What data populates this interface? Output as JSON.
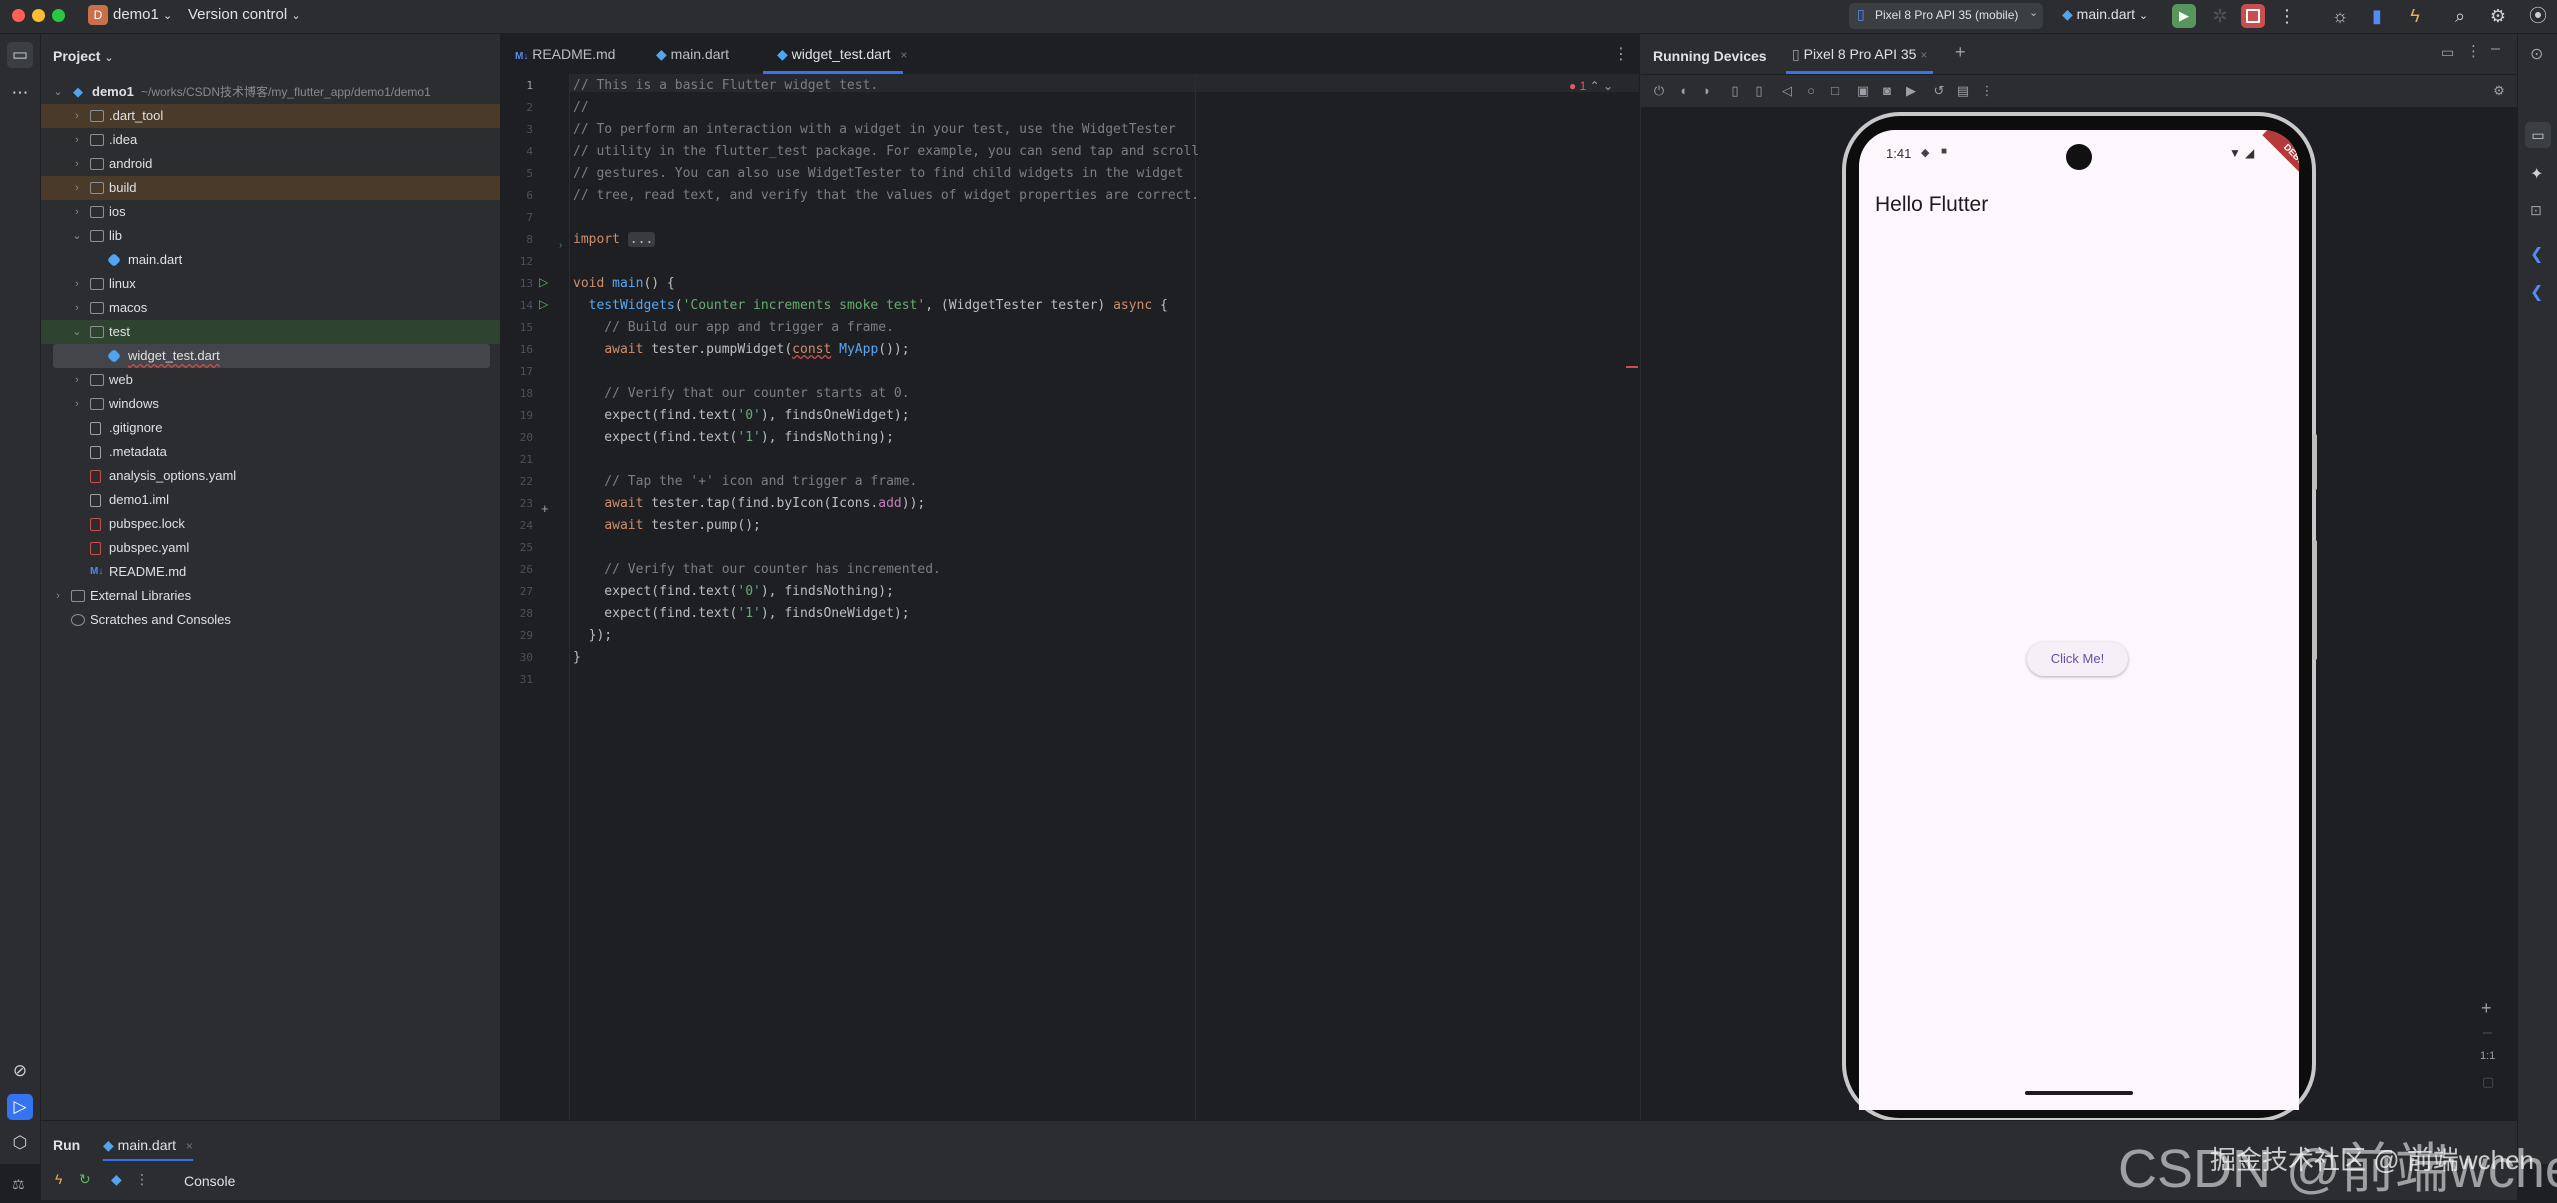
{
  "titlebar": {
    "project_badge": "D",
    "project_name": "demo1",
    "vcs": "Version control",
    "device_selector": "Pixel 8 Pro API 35 (mobile)",
    "run_config": "main.dart"
  },
  "project_panel": {
    "title": "Project",
    "root_name": "demo1",
    "root_path": "~/works/CSDN技术博客/my_flutter_app/demo1/demo1",
    "items": [
      {
        "label": ".dart_tool",
        "indent": 1,
        "arrow": "›",
        "icon": "folder"
      },
      {
        "label": ".idea",
        "indent": 1,
        "arrow": "›",
        "icon": "folder"
      },
      {
        "label": "android",
        "indent": 1,
        "arrow": "›",
        "icon": "folder"
      },
      {
        "label": "build",
        "indent": 1,
        "arrow": "›",
        "icon": "folder"
      },
      {
        "label": "ios",
        "indent": 1,
        "arrow": "›",
        "icon": "folder"
      },
      {
        "label": "lib",
        "indent": 1,
        "arrow": "⌄",
        "icon": "folder"
      },
      {
        "label": "main.dart",
        "indent": 2,
        "arrow": "",
        "icon": "dart"
      },
      {
        "label": "linux",
        "indent": 1,
        "arrow": "›",
        "icon": "folder"
      },
      {
        "label": "macos",
        "indent": 1,
        "arrow": "›",
        "icon": "folder"
      },
      {
        "label": "test",
        "indent": 1,
        "arrow": "⌄",
        "icon": "folder"
      },
      {
        "label": "widget_test.dart",
        "indent": 2,
        "arrow": "",
        "icon": "dart"
      },
      {
        "label": "web",
        "indent": 1,
        "arrow": "›",
        "icon": "folder"
      },
      {
        "label": "windows",
        "indent": 1,
        "arrow": "›",
        "icon": "folder"
      },
      {
        "label": ".gitignore",
        "indent": 1,
        "arrow": "",
        "icon": "gen"
      },
      {
        "label": ".metadata",
        "indent": 1,
        "arrow": "",
        "icon": "gen"
      },
      {
        "label": "analysis_options.yaml",
        "indent": 1,
        "arrow": "",
        "icon": "yaml"
      },
      {
        "label": "demo1.iml",
        "indent": 1,
        "arrow": "",
        "icon": "gen"
      },
      {
        "label": "pubspec.lock",
        "indent": 1,
        "arrow": "",
        "icon": "yaml"
      },
      {
        "label": "pubspec.yaml",
        "indent": 1,
        "arrow": "",
        "icon": "yaml"
      },
      {
        "label": "README.md",
        "indent": 1,
        "arrow": "",
        "icon": "md"
      },
      {
        "label": "External Libraries",
        "indent": 0,
        "arrow": "›",
        "icon": "lib"
      },
      {
        "label": "Scratches and Consoles",
        "indent": 0,
        "arrow": "",
        "icon": "scratch"
      }
    ]
  },
  "editor": {
    "tabs": [
      {
        "label": "README.md",
        "icon": "M↓"
      },
      {
        "label": "main.dart",
        "icon": ""
      },
      {
        "label": "widget_test.dart",
        "icon": ""
      }
    ],
    "error_count": "1",
    "line_numbers": [
      "1",
      "2",
      "3",
      "4",
      "5",
      "6",
      "7",
      "8",
      "12",
      "13",
      "14",
      "15",
      "16",
      "17",
      "18",
      "19",
      "20",
      "21",
      "22",
      "23",
      "24",
      "25",
      "26",
      "27",
      "28",
      "29",
      "30",
      "31"
    ],
    "lines": [
      "// This is a basic Flutter widget test.",
      "//",
      "// To perform an interaction with a widget in your test, use the WidgetTester",
      "// utility in the flutter_test package. For example, you can send tap and scroll",
      "// gestures. You can also use WidgetTester to find child widgets in the widget",
      "// tree, read text, and verify that the values of widget properties are correct.",
      "",
      "import ...",
      "",
      "void main() {",
      "  testWidgets('Counter increments smoke test', (WidgetTester tester) async {",
      "    // Build our app and trigger a frame.",
      "    await tester.pumpWidget(const MyApp());",
      "",
      "    // Verify that our counter starts at 0.",
      "    expect(find.text('0'), findsOneWidget);",
      "    expect(find.text('1'), findsNothing);",
      "",
      "    // Tap the '+' icon and trigger a frame.",
      "    await tester.tap(find.byIcon(Icons.add));",
      "    await tester.pump();",
      "",
      "    // Verify that our counter has incremented.",
      "    expect(find.text('0'), findsNothing);",
      "    expect(find.text('1'), findsOneWidget);",
      "  });",
      "}",
      ""
    ]
  },
  "devices": {
    "title": "Running Devices",
    "tab_label": "Pixel 8 Pro API 35",
    "zoom_label": "1:1"
  },
  "phone": {
    "time": "1:41",
    "debug_banner": "DEBUG",
    "app_title": "Hello Flutter",
    "button_label": "Click Me!"
  },
  "bottom": {
    "tool_title": "Run",
    "run_tab": "main.dart",
    "console_label": "Console"
  },
  "watermark": {
    "csdn": "CSDN @前端wchen",
    "juejin": "掘金技术社区 @ 前端wchen"
  },
  "colors": {
    "accent": "#3574f0",
    "run_green": "#57965c",
    "stop_red": "#c94f4f"
  }
}
